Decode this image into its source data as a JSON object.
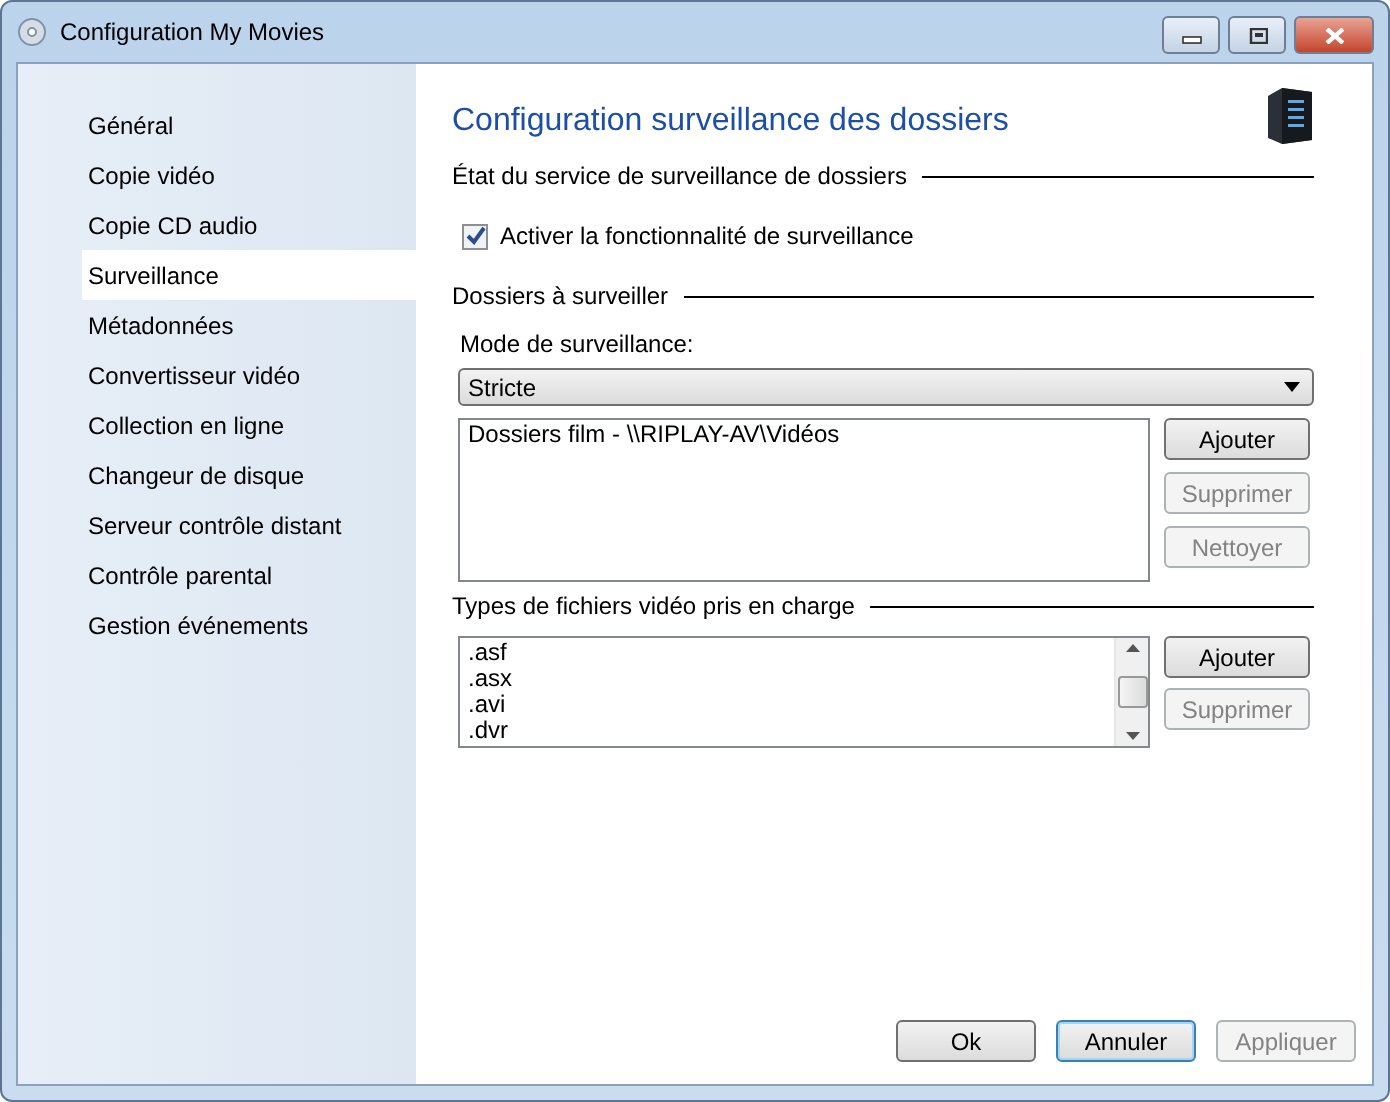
{
  "window": {
    "title": "Configuration My Movies"
  },
  "sidebar": {
    "items": [
      {
        "label": "Général",
        "selected": false
      },
      {
        "label": "Copie vidéo",
        "selected": false
      },
      {
        "label": "Copie CD audio",
        "selected": false
      },
      {
        "label": "Surveillance",
        "selected": true
      },
      {
        "label": "Métadonnées",
        "selected": false
      },
      {
        "label": "Convertisseur vidéo",
        "selected": false
      },
      {
        "label": "Collection en ligne",
        "selected": false
      },
      {
        "label": "Changeur de disque",
        "selected": false
      },
      {
        "label": "Serveur contrôle distant",
        "selected": false
      },
      {
        "label": "Contrôle parental",
        "selected": false
      },
      {
        "label": "Gestion événements",
        "selected": false
      }
    ]
  },
  "page": {
    "title": "Configuration surveillance des dossiers",
    "service_section": {
      "heading": "État du service de surveillance de dossiers",
      "checkbox": {
        "label": "Activer la fonctionnalité de surveillance",
        "checked": true
      }
    },
    "folders_section": {
      "heading": "Dossiers à surveiller",
      "mode_label": "Mode de surveillance:",
      "mode_value": "Stricte",
      "folders": [
        "Dossiers film - \\\\RIPLAY-AV\\Vidéos"
      ],
      "buttons": [
        {
          "label": "Ajouter",
          "disabled": false
        },
        {
          "label": "Supprimer",
          "disabled": true
        },
        {
          "label": "Nettoyer",
          "disabled": true
        }
      ]
    },
    "types_section": {
      "heading": "Types de fichiers vidéo pris en charge",
      "types": [
        ".asf",
        ".asx",
        ".avi",
        ".dvr"
      ],
      "buttons": [
        {
          "label": "Ajouter",
          "disabled": false
        },
        {
          "label": "Supprimer",
          "disabled": true
        }
      ]
    }
  },
  "footer_buttons": [
    {
      "label": "Ok",
      "disabled": false,
      "default": false
    },
    {
      "label": "Annuler",
      "disabled": false,
      "default": true
    },
    {
      "label": "Appliquer",
      "disabled": true,
      "default": false
    }
  ]
}
